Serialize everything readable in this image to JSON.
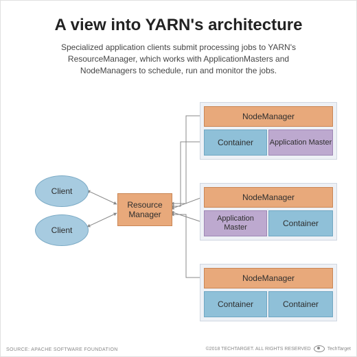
{
  "title": "A view into YARN's architecture",
  "subtitle": "Specialized application clients submit processing jobs to YARN's ResourceManager, which works with ApplicationMasters and NodeManagers to schedule, run and monitor the jobs.",
  "clients": [
    "Client",
    "Client"
  ],
  "resource_manager": "Resource Manager",
  "nodes": [
    {
      "nm": "NodeManager",
      "left": "Container",
      "right": "Application Master",
      "right_is_am": true
    },
    {
      "nm": "NodeManager",
      "left": "Application Master",
      "right": "Container",
      "left_is_am": true
    },
    {
      "nm": "NodeManager",
      "left": "Container",
      "right": "Container"
    }
  ],
  "footer_source": "SOURCE: APACHE SOFTWARE FOUNDATION",
  "footer_rights": "©2018 TECHTARGET. ALL RIGHTS RESERVED",
  "footer_brand": "TechTarget"
}
